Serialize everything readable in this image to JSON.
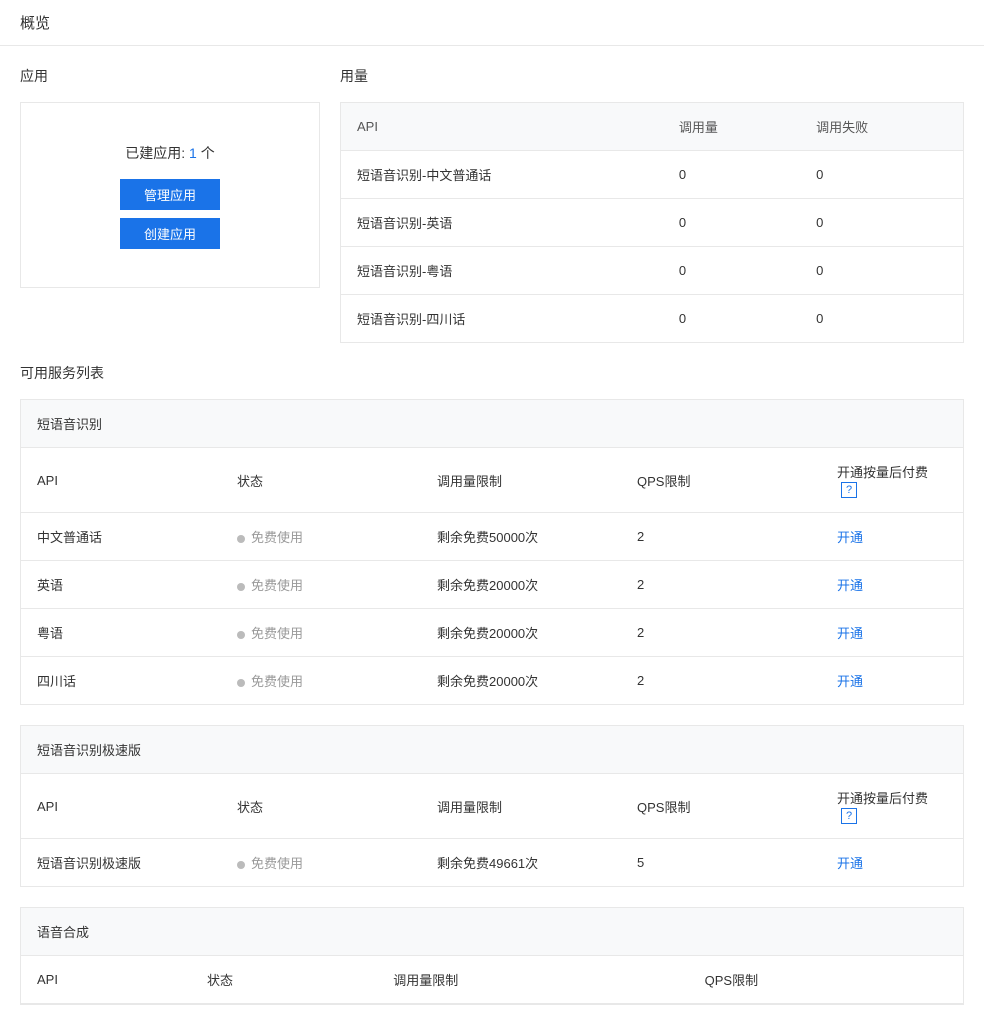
{
  "page_title": "概览",
  "app": {
    "section_label": "应用",
    "count_label": "已建应用:",
    "count": "1",
    "count_unit": "个",
    "manage_btn": "管理应用",
    "create_btn": "创建应用"
  },
  "usage": {
    "section_label": "用量",
    "headers": {
      "api": "API",
      "calls": "调用量",
      "fails": "调用失败"
    },
    "rows": [
      {
        "api": "短语音识别-中文普通话",
        "calls": "0",
        "fails": "0"
      },
      {
        "api": "短语音识别-英语",
        "calls": "0",
        "fails": "0"
      },
      {
        "api": "短语音识别-粤语",
        "calls": "0",
        "fails": "0"
      },
      {
        "api": "短语音识别-四川话",
        "calls": "0",
        "fails": "0"
      }
    ]
  },
  "services_title": "可用服务列表",
  "service_headers": {
    "api": "API",
    "status": "状态",
    "limit": "调用量限制",
    "qps": "QPS限制",
    "postpay": "开通按量后付费",
    "help": "?"
  },
  "action_open": "开通",
  "groups": [
    {
      "title": "短语音识别",
      "show_postpay": true,
      "rows": [
        {
          "api": "中文普通话",
          "status": "免费使用",
          "limit": "剩余免费50000次",
          "qps": "2"
        },
        {
          "api": "英语",
          "status": "免费使用",
          "limit": "剩余免费20000次",
          "qps": "2"
        },
        {
          "api": "粤语",
          "status": "免费使用",
          "limit": "剩余免费20000次",
          "qps": "2"
        },
        {
          "api": "四川话",
          "status": "免费使用",
          "limit": "剩余免费20000次",
          "qps": "2"
        }
      ]
    },
    {
      "title": "短语音识别极速版",
      "show_postpay": true,
      "rows": [
        {
          "api": "短语音识别极速版",
          "status": "免费使用",
          "limit": "剩余免费49661次",
          "qps": "5"
        }
      ]
    },
    {
      "title": "语音合成",
      "show_postpay": false,
      "rows": []
    }
  ],
  "synth_headers": {
    "api": "API",
    "status": "状态",
    "limit": "调用量限制",
    "qps": "QPS限制"
  }
}
